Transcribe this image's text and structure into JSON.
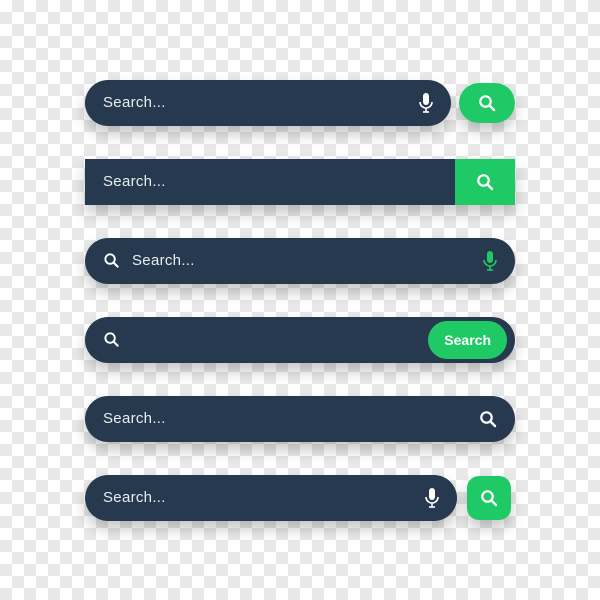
{
  "colors": {
    "bar_bg": "#26394e",
    "accent": "#1fc966",
    "icon_light": "#ffffff"
  },
  "bars": {
    "row1": {
      "placeholder": "Search..."
    },
    "row2": {
      "placeholder": "Search..."
    },
    "row3": {
      "placeholder": "Search..."
    },
    "row4": {
      "placeholder": "",
      "button_label": "Search"
    },
    "row5": {
      "placeholder": "Search..."
    },
    "row6": {
      "placeholder": "Search..."
    }
  },
  "icons": {
    "search": "search-icon",
    "mic": "microphone-icon"
  }
}
